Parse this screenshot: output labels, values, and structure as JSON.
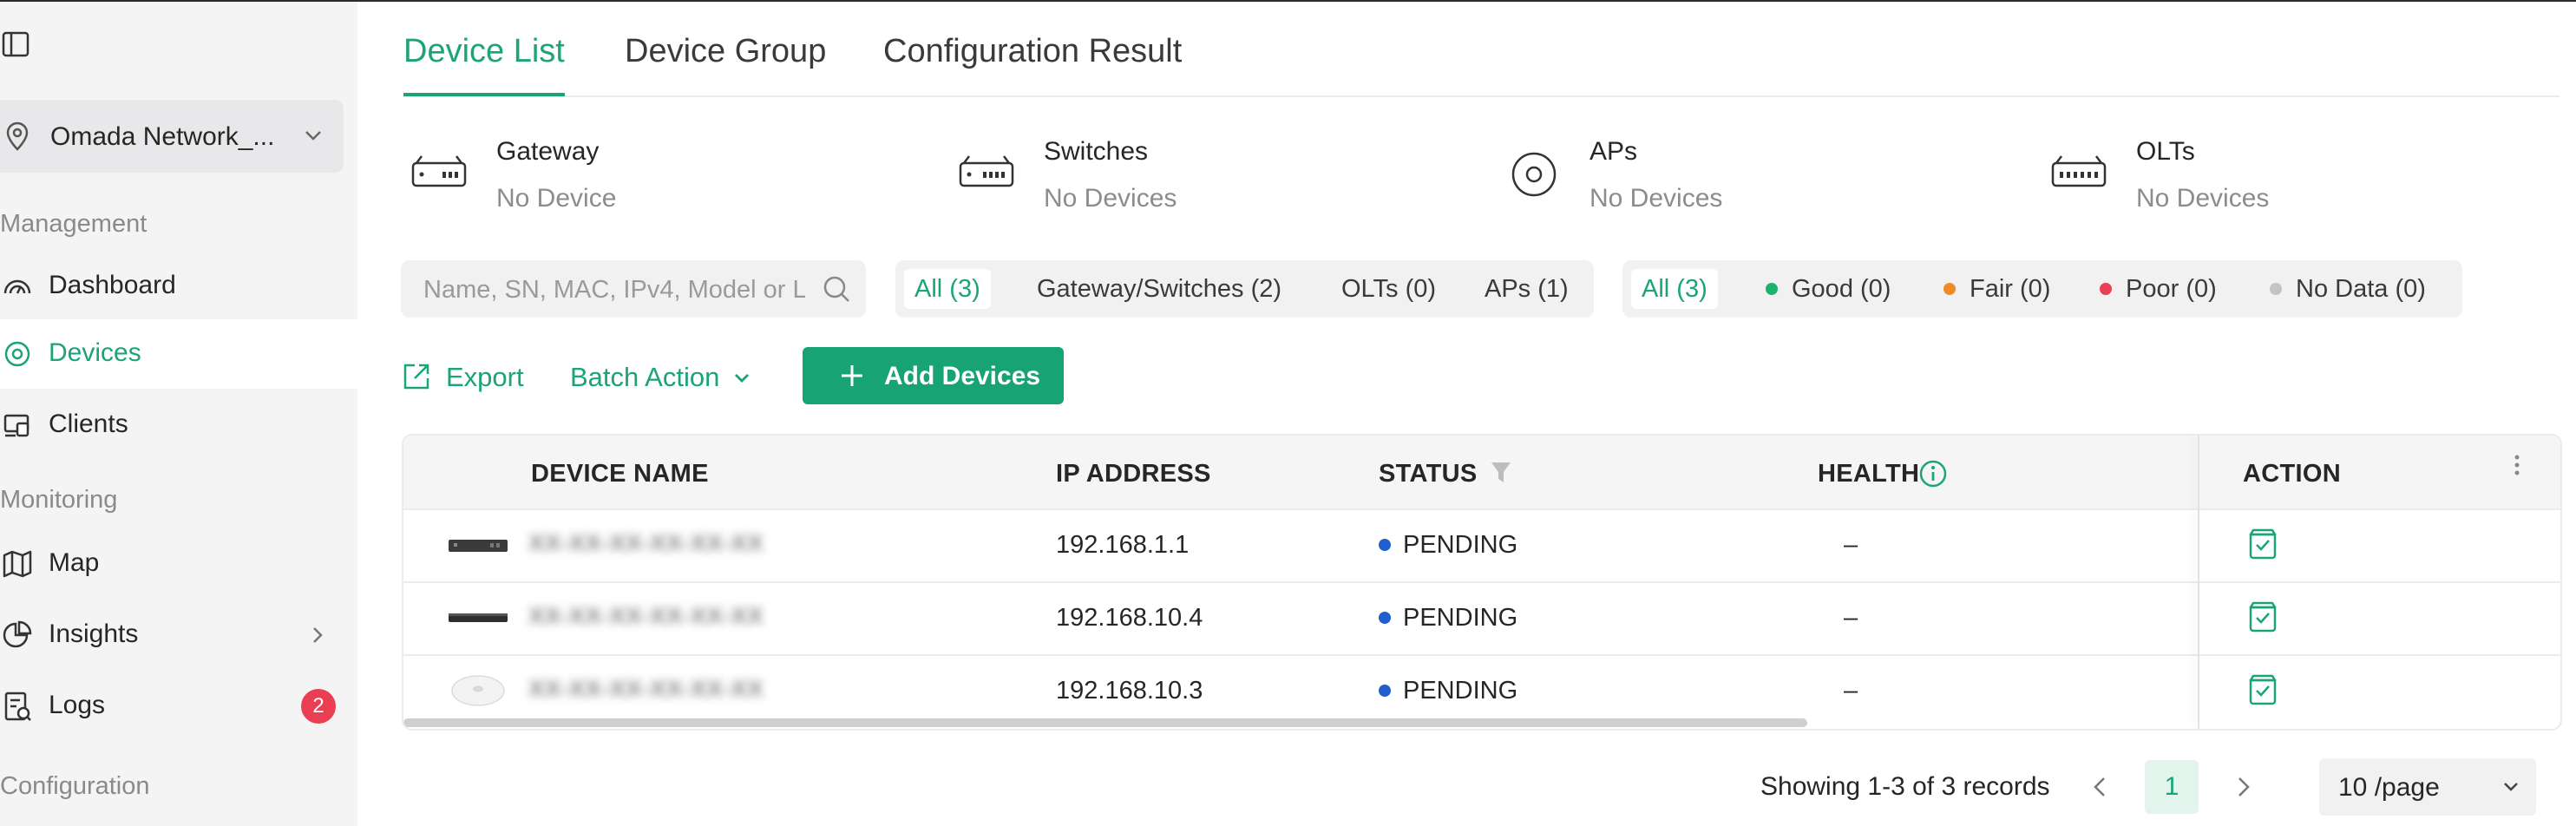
{
  "sidebar": {
    "site_name": "Omada Network_...",
    "sections": {
      "management": "Management",
      "monitoring": "Monitoring",
      "configuration": "Configuration"
    },
    "items": {
      "dashboard": "Dashboard",
      "devices": "Devices",
      "clients": "Clients",
      "map": "Map",
      "insights": "Insights",
      "logs": "Logs"
    },
    "logs_badge": "2",
    "active_item": "Devices"
  },
  "tabs": [
    "Device List",
    "Device Group",
    "Configuration Result"
  ],
  "summary": [
    {
      "title": "Gateway",
      "status": "No Device",
      "icon": "gateway-icon"
    },
    {
      "title": "Switches",
      "status": "No Devices",
      "icon": "switch-icon"
    },
    {
      "title": "APs",
      "status": "No Devices",
      "icon": "ap-icon"
    },
    {
      "title": "OLTs",
      "status": "No Devices",
      "icon": "olt-icon"
    }
  ],
  "search": {
    "placeholder": "Name, SN, MAC, IPv4, Model or L..."
  },
  "type_filter": {
    "all": "All (3)",
    "gateway_switches": "Gateway/Switches (2)",
    "olts": "OLTs (0)",
    "aps": "APs (1)"
  },
  "health_filter": {
    "all": "All (3)",
    "good": "Good (0)",
    "fair": "Fair (0)",
    "poor": "Poor (0)",
    "no_data": "No Data (0)"
  },
  "toolbar": {
    "export": "Export",
    "batch_action": "Batch Action",
    "add_devices": "Add Devices"
  },
  "table": {
    "columns": {
      "device_name": "DEVICE NAME",
      "ip_address": "IP ADDRESS",
      "status": "STATUS",
      "health": "HEALTH",
      "action": "ACTION"
    },
    "rows": [
      {
        "name": "XX-XX-XX-XX-XX-XX",
        "ip": "192.168.1.1",
        "status": "PENDING",
        "health": "–",
        "device_icon": "gateway-device-image"
      },
      {
        "name": "XX-XX-XX-XX-XX-XX",
        "ip": "192.168.10.4",
        "status": "PENDING",
        "health": "–",
        "device_icon": "switch-device-image"
      },
      {
        "name": "XX-XX-XX-XX-XX-XX",
        "ip": "192.168.10.3",
        "status": "PENDING",
        "health": "–",
        "device_icon": "ap-device-image"
      }
    ]
  },
  "pagination": {
    "info": "Showing 1-3 of 3 records",
    "current_page": "1",
    "page_size": "10 /page"
  },
  "colors": {
    "accent": "#1ba37a",
    "good": "#1bb36b",
    "fair": "#f08a24",
    "poor": "#ea3e52",
    "no_data": "#c4c4c4",
    "pending": "#1f5fd0",
    "badge": "#ea3e52"
  }
}
